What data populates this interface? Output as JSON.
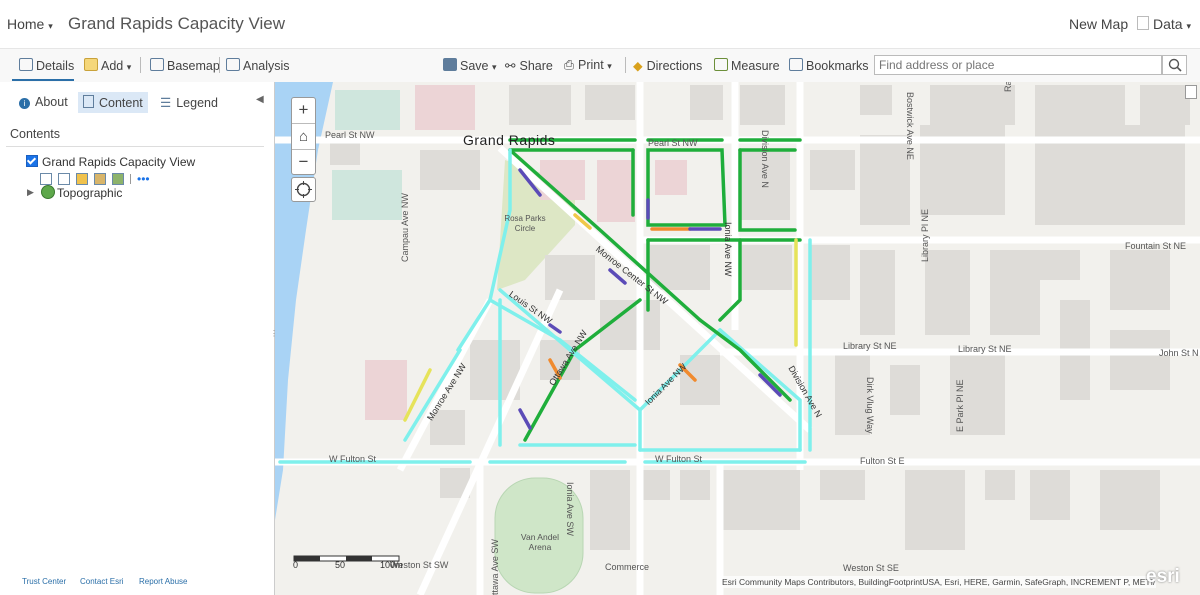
{
  "header": {
    "home_label": "Home",
    "title": "Grand Rapids Capacity View",
    "new_map_label": "New Map",
    "data_label": "Data"
  },
  "toolbar": {
    "details": "Details",
    "add": "Add",
    "basemap": "Basemap",
    "analysis": "Analysis",
    "save": "Save",
    "share": "Share",
    "print": "Print",
    "directions": "Directions",
    "measure": "Measure",
    "bookmarks": "Bookmarks",
    "search_placeholder": "Find address or place"
  },
  "sidebar": {
    "tabs": [
      "About",
      "Content",
      "Legend"
    ],
    "contents_heading": "Contents",
    "layers": {
      "main": "Grand Rapids Capacity View",
      "basemap": "Topographic"
    },
    "footer": [
      "Trust Center",
      "Contact Esri",
      "Report Abuse"
    ]
  },
  "map": {
    "city_label": "Grand Rapids",
    "streets": [
      "Pearl St NW",
      "Pearl St NW",
      "Division Ave N",
      "Bostwick Ave NE",
      "Ransom Ave NE",
      "Fountain St NE",
      "Campau Ave NW",
      "Monroe Center St NW",
      "Ionia Ave NW",
      "Louis St NW",
      "Library Pl NE",
      "Library St NE",
      "Library St NE",
      "John St N",
      "Ottawa Ave NW",
      "Monroe Ave NW",
      "Ionia Ave NW",
      "Division Ave N",
      "Dirk Vlug Way",
      "E Park Pl NE",
      "W Fulton St",
      "W Fulton St",
      "Fulton St E",
      "Ionia Ave SW",
      "Ottawa Ave SW",
      "Weston St SW",
      "Weston St SE",
      "Commerce"
    ],
    "place_labels": [
      "Rosa Parks Circle",
      "Van Andel Arena"
    ],
    "zoom_in": "+",
    "zoom_out": "−",
    "scale_ticks": [
      "0",
      "50",
      "100m"
    ],
    "attribution": "Esri Community Maps Contributors, BuildingFootprintUSA, Esri, HERE, Garmin, SafeGraph, INCREMENT P, METI/N...",
    "brand": "esri"
  },
  "colors": {
    "accent": "#2b6fa8",
    "segment_green": "#1fae3b",
    "segment_cyan": "#7ff0ec",
    "segment_orange": "#f08a2e",
    "segment_purple": "#5b4bb7",
    "segment_yellow": "#e6e35a",
    "water": "#a9d3f5"
  }
}
